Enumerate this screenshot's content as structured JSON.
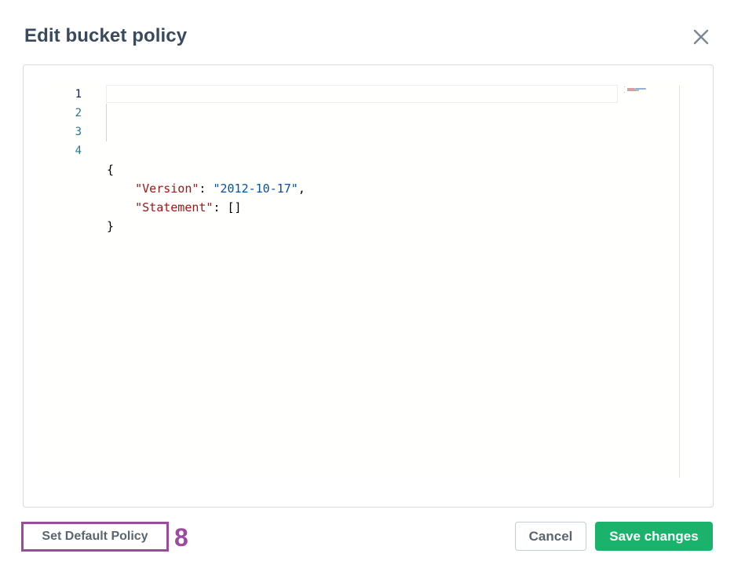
{
  "dialog": {
    "title": "Edit bucket policy",
    "close_icon": "close-icon"
  },
  "editor": {
    "language": "json",
    "active_line": 1,
    "lines": [
      {
        "number": "1",
        "indent": "",
        "parts": [
          {
            "type": "punc",
            "text": "{"
          }
        ]
      },
      {
        "number": "2",
        "indent": "    ",
        "parts": [
          {
            "type": "key",
            "text": "\"Version\""
          },
          {
            "type": "punc",
            "text": ": "
          },
          {
            "type": "str",
            "text": "\"2012-10-17\""
          },
          {
            "type": "punc",
            "text": ","
          }
        ]
      },
      {
        "number": "3",
        "indent": "    ",
        "parts": [
          {
            "type": "key",
            "text": "\"Statement\""
          },
          {
            "type": "punc",
            "text": ": []"
          }
        ]
      },
      {
        "number": "4",
        "indent": "",
        "parts": [
          {
            "type": "punc",
            "text": "}"
          }
        ]
      }
    ]
  },
  "footer": {
    "set_default_label": "Set Default Policy",
    "step_marker": "8",
    "cancel_label": "Cancel",
    "save_label": "Save changes"
  },
  "colors": {
    "title": "#3a4a5c",
    "key_token": "#a31515",
    "string_token": "#0451a5",
    "line_number": "#237893",
    "save_button": "#1bb36b",
    "highlight_box": "#9b4a9f"
  }
}
